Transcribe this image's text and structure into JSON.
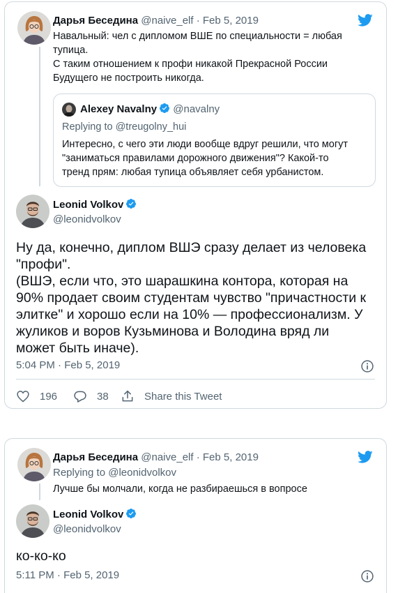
{
  "tweet1": {
    "parent": {
      "name": "Дарья Беседина",
      "handle": "@naive_elf",
      "sep": "·",
      "date": "Feb 5, 2019",
      "lines": [
        "Навальный: чел с дипломом ВШЕ по специальности = любая",
        "тупица.",
        "С таким отношением к профи никакой Прекрасной России",
        "Будущего не построить никогда."
      ]
    },
    "quote": {
      "name": "Alexey Navalny",
      "handle": "@navalny",
      "replying_prefix": "Replying to",
      "replying_handle": "@treugolny_hui",
      "lines": [
        "Интересно, с чего эти люди вообще вдруг решили, что могут",
        "\"заниматься правилами дорожного движения\"? Какой-то",
        "тренд прям: любая тупица объявляет себя урбанистом."
      ]
    },
    "main": {
      "name": "Leonid Volkov",
      "handle": "@leonidvolkov",
      "lines": [
        "Ну да, конечно, диплом ВШЭ сразу делает из человека",
        "\"профи\".",
        "(ВШЭ, если что, это шарашкина контора, которая на",
        "90% продает своим студентам чувство \"причастности к",
        "элитке\" и хорошо если на 10% — профессионализм. У",
        "жуликов и воров Кузьминова и Володина вряд ли",
        "может быть иначе)."
      ],
      "time": "5:04 PM · Feb 5, 2019",
      "likes": "196",
      "replies": "38",
      "share_label": "Share this Tweet"
    }
  },
  "tweet2": {
    "parent": {
      "name": "Дарья Беседина",
      "handle": "@naive_elf",
      "sep": "·",
      "date": "Feb 5, 2019",
      "replying_prefix": "Replying to",
      "replying_handle": "@leonidvolkov",
      "text": "Лучше бы молчали, когда не разбираешься в вопросе"
    },
    "main": {
      "name": "Leonid Volkov",
      "handle": "@leonidvolkov",
      "text": "ко-ко-ко",
      "time": "5:11 PM · Feb 5, 2019"
    }
  },
  "colors": {
    "twitter_blue": "#1d9bf0",
    "border": "#cfd9de",
    "muted": "#536471",
    "text": "#0f1419"
  },
  "icons": [
    "twitter-bird-icon",
    "verified-badge-icon",
    "info-icon",
    "heart-icon",
    "reply-icon",
    "share-icon"
  ]
}
